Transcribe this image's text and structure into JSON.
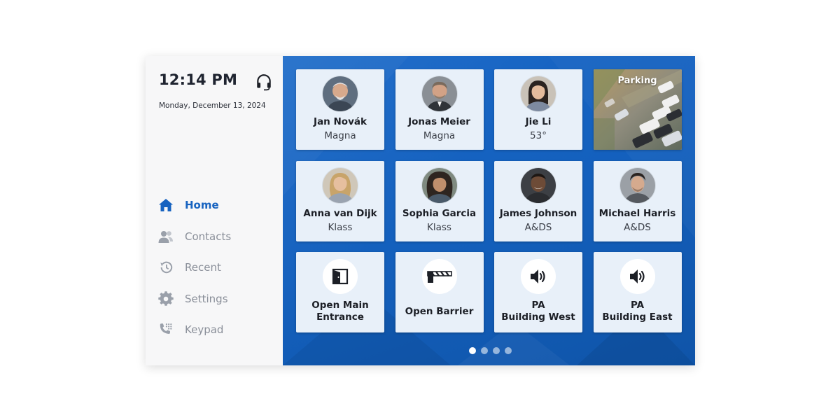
{
  "header": {
    "time": "12:14 PM",
    "date": "Monday, December 13, 2024",
    "support_icon": "headset-icon"
  },
  "sidebar": {
    "items": [
      {
        "label": "Home",
        "icon": "home-icon",
        "active": true
      },
      {
        "label": "Contacts",
        "icon": "contacts-icon",
        "active": false
      },
      {
        "label": "Recent",
        "icon": "history-icon",
        "active": false
      },
      {
        "label": "Settings",
        "icon": "gear-icon",
        "active": false
      },
      {
        "label": "Keypad",
        "icon": "phone-keypad-icon",
        "active": false
      }
    ]
  },
  "tiles": {
    "contacts": [
      {
        "name": "Jan Novák",
        "sub": "Magna"
      },
      {
        "name": "Jonas Meier",
        "sub": "Magna"
      },
      {
        "name": "Jie Li",
        "sub": "53°"
      },
      {
        "name": "Anna van Dijk",
        "sub": "Klass"
      },
      {
        "name": "Sophia Garcia",
        "sub": "Klass"
      },
      {
        "name": "James Johnson",
        "sub": "A&DS"
      },
      {
        "name": "Michael Harris",
        "sub": "A&DS"
      }
    ],
    "camera": {
      "label": "Parking"
    },
    "actions": [
      {
        "line1": "Open Main",
        "line2": "Entrance",
        "icon": "door-icon"
      },
      {
        "line1": "Open Barrier",
        "line2": "",
        "icon": "barrier-gate-icon"
      },
      {
        "line1": "PA",
        "line2": "Building West",
        "icon": "speaker-icon"
      },
      {
        "line1": "PA",
        "line2": "Building East",
        "icon": "speaker-icon"
      }
    ]
  },
  "pager": {
    "pages": 4,
    "current": 1
  },
  "colors": {
    "accent": "#1763c0",
    "panel_blue": "#1565c4",
    "tile_bg": "#e8f0f9",
    "sidebar_bg": "#f7f7f8"
  }
}
